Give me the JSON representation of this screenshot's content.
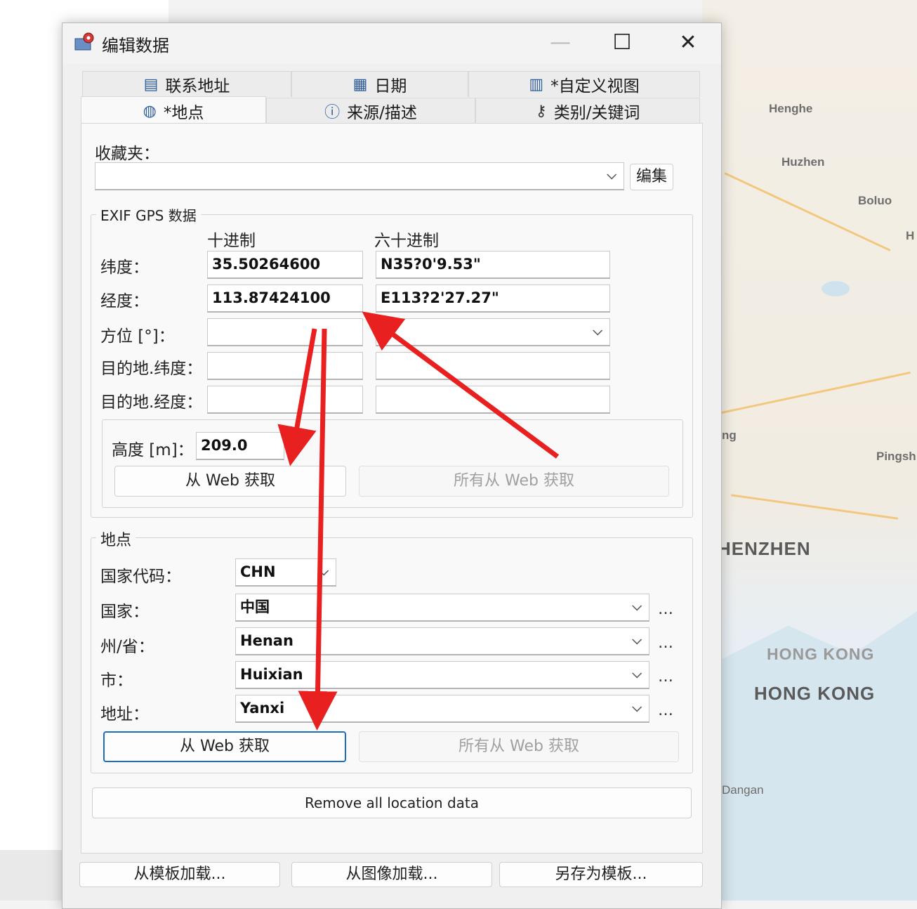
{
  "dialog": {
    "title": "编辑数据",
    "window_controls": {
      "minimize": "—",
      "maximize": "☐",
      "close": "✕"
    }
  },
  "tabs_row1": [
    {
      "label": "联系地址",
      "icon": "contact-card-icon"
    },
    {
      "label": "日期",
      "icon": "calendar-icon"
    },
    {
      "label": "*自定义视图",
      "icon": "table-view-icon"
    }
  ],
  "tabs_row2": [
    {
      "label": "*地点",
      "icon": "globe-icon",
      "active": true
    },
    {
      "label": "来源/描述",
      "icon": "info-icon"
    },
    {
      "label": "类别/关键词",
      "icon": "key-icon"
    }
  ],
  "favorites": {
    "label": "收藏夹：",
    "value": "",
    "edit_button": "编集"
  },
  "gps": {
    "group_title": "EXIF GPS 数据",
    "col_decimal": "十进制",
    "col_sexagesimal": "六十进制",
    "latitude_label": "纬度：",
    "latitude_decimal": "35.50264600",
    "latitude_sexagesimal": "N35?0'9.53\"",
    "longitude_label": "经度：",
    "longitude_decimal": "113.87424100",
    "longitude_sexagesimal": "E113?2'27.27\"",
    "bearing_label": "方位 [°]：",
    "dest_lat_label": "目的地.纬度：",
    "dest_lon_label": "目的地.经度：",
    "altitude_label": "高度 [m]：",
    "altitude_value": "209.0",
    "fetch_button": "从 Web 获取",
    "fetch_all_button": "所有从 Web 获取"
  },
  "location": {
    "group_title": "地点",
    "country_code_label": "国家代码：",
    "country_code": "CHN",
    "country_label": "国家：",
    "country": "中国",
    "province_label": "州/省：",
    "province": "Henan",
    "city_label": "市：",
    "city": "Huixian",
    "address_label": "地址：",
    "address": "Yanxi",
    "more": "…",
    "fetch_button": "从 Web 获取",
    "fetch_all_button": "所有从 Web 获取"
  },
  "remove_button": "Remove all location data",
  "footer": {
    "load_template": "从模板加载...",
    "load_image": "从图像加载...",
    "save_template": "另存为模板..."
  },
  "map_labels": {
    "henghe": "Henghe",
    "huzhen": "Huzhen",
    "boluo": "Boluo",
    "h": "H",
    "ng": "ng",
    "pingsh": "Pingsh",
    "shenzhen": "HENZHEN",
    "hongkong1": "HONG KONG",
    "hongkong2": "HONG KONG",
    "dangan": "Dangan"
  },
  "colors": {
    "accent": "#1f6ebd",
    "annotation_arrow": "#e8201f"
  }
}
